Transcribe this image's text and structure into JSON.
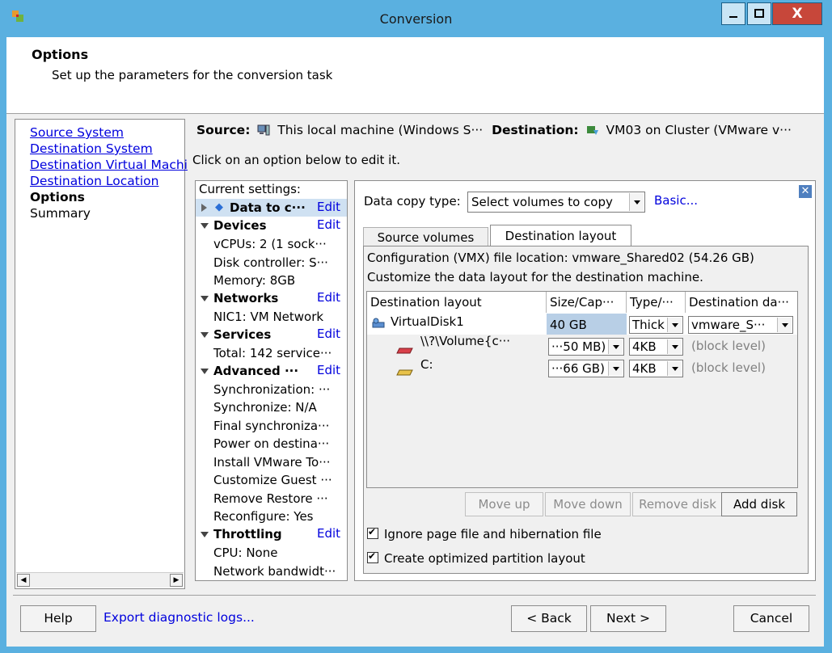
{
  "window": {
    "title": "Conversion",
    "close_glyph": "X"
  },
  "header": {
    "title": "Options",
    "subtitle": "Set up the parameters for the conversion task"
  },
  "nav": {
    "items": [
      {
        "label": "Source System",
        "state": "link"
      },
      {
        "label": "Destination System",
        "state": "link"
      },
      {
        "label": "Destination Virtual Machi",
        "state": "link"
      },
      {
        "label": "Destination Location",
        "state": "link"
      },
      {
        "label": "Options",
        "state": "current"
      },
      {
        "label": "Summary",
        "state": "plain"
      }
    ]
  },
  "srcdest": {
    "source_label": "Source:",
    "source_value": "This local machine (Windows S···",
    "destination_label": "Destination:",
    "destination_value": "VM03 on Cluster (VMware v···"
  },
  "hint": "Click on an option below to edit it.",
  "settings": {
    "heading": "Current settings:",
    "edit_label": "Edit",
    "data_to_copy": "Data to c···",
    "devices": {
      "label": "Devices",
      "items": [
        "vCPUs: 2 (1 sock···",
        "Disk controller: S···",
        "Memory: 8GB"
      ]
    },
    "networks": {
      "label": "Networks",
      "items": [
        "NIC1: VM Network"
      ]
    },
    "services": {
      "label": "Services",
      "items": [
        "Total: 142 service···"
      ]
    },
    "advanced": {
      "label": "Advanced ···",
      "items": [
        "Synchronization: ···",
        "Synchronize: N/A",
        "Final synchroniza···",
        "Power on destina···",
        "Install VMware To···",
        "Customize Guest ···",
        "Remove Restore ···",
        "Reconfigure: Yes"
      ]
    },
    "throttling": {
      "label": "Throttling",
      "items": [
        "CPU: None",
        "Network bandwidt···"
      ]
    }
  },
  "panel": {
    "data_copy_type_label": "Data copy type:",
    "data_copy_type_value": "Select volumes to copy",
    "basic_link": "Basic...",
    "tabs": [
      "Source volumes",
      "Destination layout"
    ],
    "config_line": "Configuration (VMX) file location: vmware_Shared02 (54.26 GB)",
    "customize_line": "Customize the data layout for the destination machine.",
    "grid": {
      "headers": [
        "Destination layout",
        "Size/Cap···",
        "Type/···",
        "Destination da···"
      ],
      "disk": {
        "name": "VirtualDisk1",
        "size": "40 GB",
        "type": "Thick",
        "datastore": "vmware_S···"
      },
      "volumes": [
        {
          "name": "\\\\?\\Volume{c···",
          "size": "···50 MB)",
          "cluster": "4KB",
          "level": "(block level)"
        },
        {
          "name": "C:",
          "size": "···66 GB)",
          "cluster": "4KB",
          "level": "(block level)"
        }
      ]
    },
    "buttons": {
      "move_up": "Move up",
      "move_down": "Move down",
      "remove_disk": "Remove disk",
      "add_disk": "Add disk"
    },
    "checks": [
      {
        "label": "Ignore page file and hibernation file",
        "checked": true
      },
      {
        "label": "Create optimized partition layout",
        "checked": true
      }
    ]
  },
  "footer": {
    "help": "Help",
    "export": "Export diagnostic logs...",
    "back": "< Back",
    "next": "Next >",
    "cancel": "Cancel"
  },
  "colors": {
    "frame": "#5ab0e0",
    "link": "#0000dd",
    "selected": "#cfe1f2",
    "close_button": "#c7473a"
  }
}
